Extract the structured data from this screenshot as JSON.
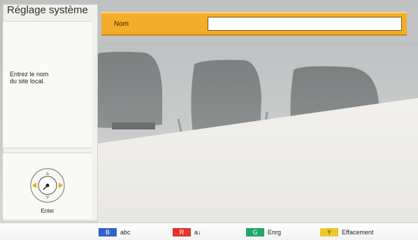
{
  "panel": {
    "title": "Réglage système",
    "info_lines": [
      "Entrez le nom",
      "du site local."
    ],
    "enter_label": "Enter"
  },
  "form": {
    "field_label": "Nom",
    "field_value": "",
    "accent_color": "#f2ad2a"
  },
  "keys": [
    {
      "key": "B",
      "label": "abc",
      "color": "#2f63c6"
    },
    {
      "key": "R",
      "label": "a↓",
      "color": "#e2342c"
    },
    {
      "key": "G",
      "label": "Enrg",
      "color": "#1fa76b"
    },
    {
      "key": "Y",
      "label": "Effacement",
      "color": "#f3c52c"
    }
  ],
  "icons": {
    "navigation": "dpad-icon"
  }
}
